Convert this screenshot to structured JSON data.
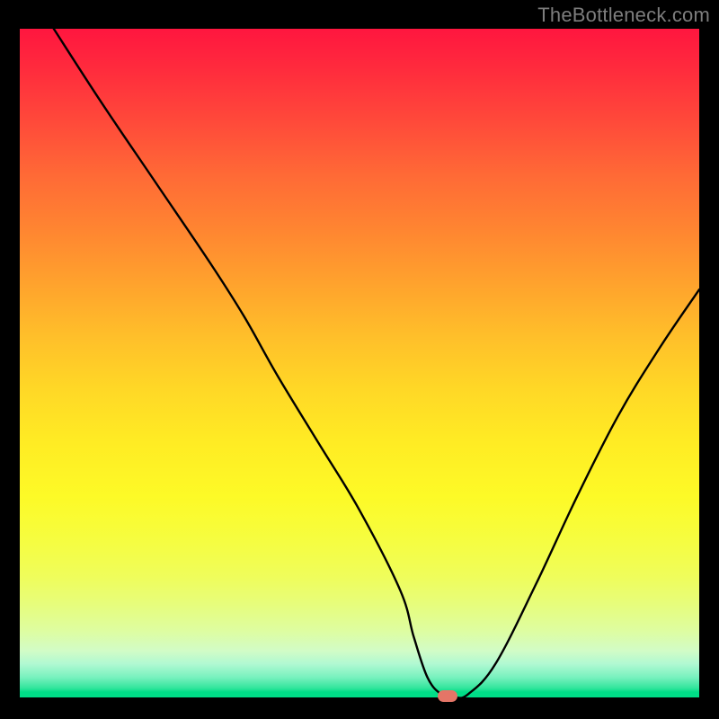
{
  "watermark": "TheBottleneck.com",
  "chart_data": {
    "type": "line",
    "title": "",
    "xlabel": "",
    "ylabel": "",
    "xlim": [
      0,
      100
    ],
    "ylim": [
      0,
      100
    ],
    "grid": false,
    "series": [
      {
        "name": "bottleneck-curve",
        "x": [
          5,
          12,
          20,
          28,
          33,
          38,
          44,
          50,
          56,
          58,
          60,
          62,
          64,
          66,
          70,
          76,
          82,
          88,
          94,
          100
        ],
        "values": [
          100,
          89,
          77,
          65,
          57,
          48,
          38,
          28,
          16,
          9,
          3,
          0.5,
          0,
          0.5,
          5,
          17,
          30,
          42,
          52,
          61
        ]
      }
    ],
    "marker": {
      "x": 63,
      "y": 0.3,
      "color": "#e47567"
    },
    "background_gradient": {
      "top": "#ff163f",
      "mid": "#ffec24",
      "bottom": "#00dd87"
    }
  }
}
